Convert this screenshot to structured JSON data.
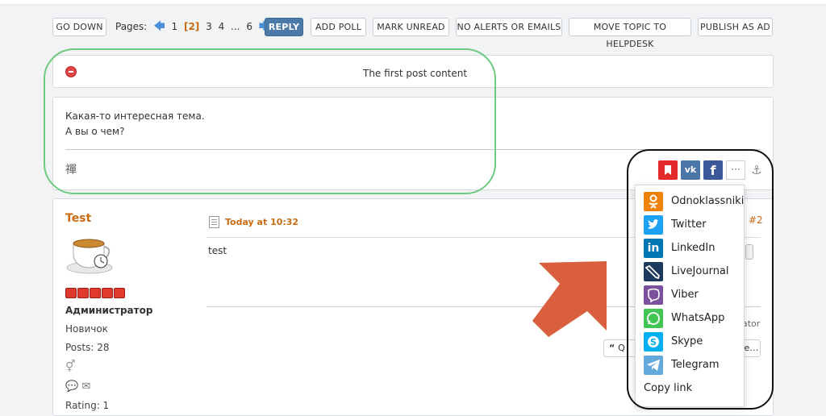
{
  "toolbar": {
    "go_down": "GO DOWN",
    "pages_label": "Pages:",
    "pages": [
      "1",
      "[2]",
      "3",
      "4",
      "...",
      "6"
    ],
    "reply": "REPLY",
    "add_poll": "ADD POLL",
    "mark_unread": "MARK UNREAD",
    "no_alerts": "NO ALERTS OR EMAILS",
    "move_topic": "MOVE TOPIC TO HELPDESK",
    "publish_ad": "PUBLISH AS AD"
  },
  "first_post": {
    "header": "The first post content",
    "line1": "Какая-то интересная тема.",
    "line2": "А вы о чем?",
    "signature": "禪"
  },
  "reply_post": {
    "author": "Test",
    "role": "Администратор",
    "rank": "Новичок",
    "posts": "Posts: 28",
    "rating": "Rating: 1",
    "date": "Today at 10:32",
    "number": "#2",
    "text": "test",
    "quote_fragment": "Q",
    "more_fragment": "e...",
    "moderator_fragment": "ator"
  },
  "share_menu": {
    "items": [
      {
        "label": "Odnoklassniki",
        "icon": "odnoklassniki-icon",
        "color": "#ee8208"
      },
      {
        "label": "Twitter",
        "icon": "twitter-icon",
        "color": "#1da1f2"
      },
      {
        "label": "LinkedIn",
        "icon": "linkedin-icon",
        "color": "#0077b5"
      },
      {
        "label": "LiveJournal",
        "icon": "livejournal-icon",
        "color": "#1d3a5c"
      },
      {
        "label": "Viber",
        "icon": "viber-icon",
        "color": "#7b519d"
      },
      {
        "label": "WhatsApp",
        "icon": "whatsapp-icon",
        "color": "#43c553"
      },
      {
        "label": "Skype",
        "icon": "skype-icon",
        "color": "#00aff0"
      },
      {
        "label": "Telegram",
        "icon": "telegram-icon",
        "color": "#64a9dc"
      }
    ],
    "copy_link": "Copy link"
  },
  "colors": {
    "accent": "#c86b12",
    "reply_button": "#4b79a8",
    "highlight_green": "#6ccb7e",
    "arrow": "#d95f3e",
    "bookmark": "#e32a2a",
    "vk": "#4a76a8",
    "facebook": "#3b5998"
  }
}
